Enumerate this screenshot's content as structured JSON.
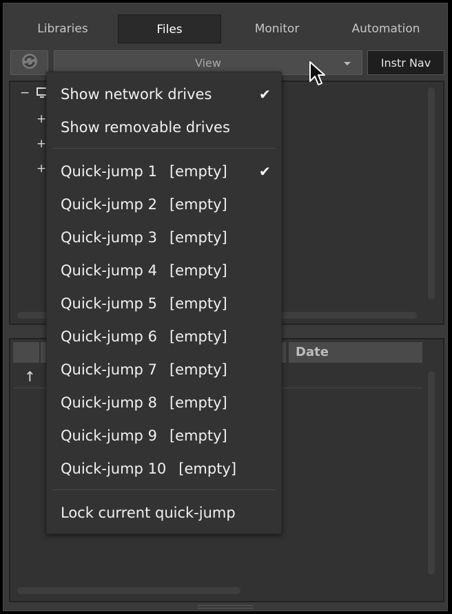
{
  "tabs": [
    {
      "label": "Libraries",
      "active": false
    },
    {
      "label": "Files",
      "active": true
    },
    {
      "label": "Monitor",
      "active": false
    },
    {
      "label": "Automation",
      "active": false
    }
  ],
  "toolbar": {
    "refresh_icon": "refresh-icon",
    "view_label": "View",
    "instr_nav_label": "Instr Nav"
  },
  "tree": {
    "expanders": [
      "−",
      "+",
      "+",
      "+"
    ]
  },
  "file_list": {
    "columns": [
      "",
      "",
      "Date"
    ],
    "up_arrow": "↑"
  },
  "menu": {
    "items": [
      {
        "label": "Show network drives",
        "tag": "",
        "checked": true
      },
      {
        "label": "Show removable drives",
        "tag": "",
        "checked": false
      },
      {
        "label": "Quick-jump 1",
        "tag": "[empty]",
        "checked": true
      },
      {
        "label": "Quick-jump 2",
        "tag": "[empty]",
        "checked": false
      },
      {
        "label": "Quick-jump 3",
        "tag": "[empty]",
        "checked": false
      },
      {
        "label": "Quick-jump 4",
        "tag": "[empty]",
        "checked": false
      },
      {
        "label": "Quick-jump 5",
        "tag": "[empty]",
        "checked": false
      },
      {
        "label": "Quick-jump 6",
        "tag": "[empty]",
        "checked": false
      },
      {
        "label": "Quick-jump 7",
        "tag": "[empty]",
        "checked": false
      },
      {
        "label": "Quick-jump 8",
        "tag": "[empty]",
        "checked": false
      },
      {
        "label": "Quick-jump 9",
        "tag": "[empty]",
        "checked": false
      },
      {
        "label": "Quick-jump 10",
        "tag": "[empty]",
        "checked": false
      },
      {
        "label": "Lock current quick-jump",
        "tag": "",
        "checked": false
      }
    ],
    "check_glyph": "✔"
  },
  "colors": {
    "background": "#3a3a3a",
    "menu_bg": "#333333",
    "active_tab": "#2a2a2a",
    "text": "#f1f1f1"
  }
}
